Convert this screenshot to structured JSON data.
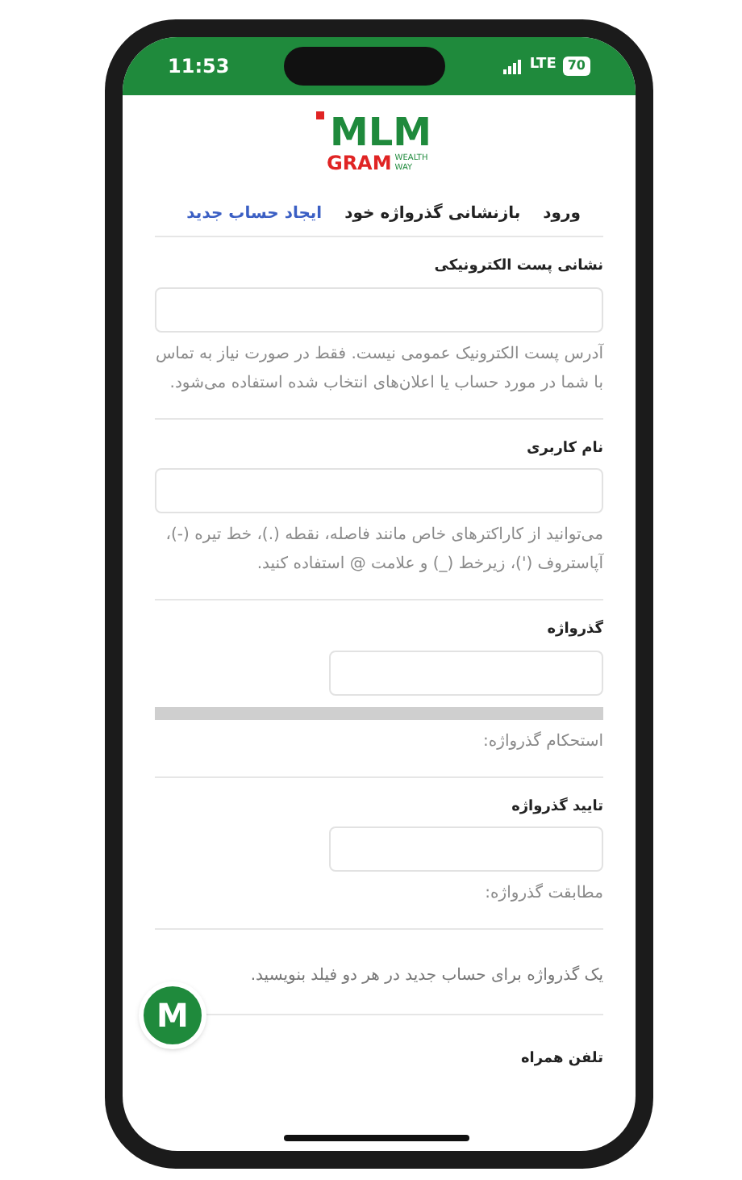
{
  "status_bar": {
    "time": "11:53",
    "network": "LTE",
    "battery": "70"
  },
  "logo": {
    "mark": "MLM",
    "word": "GRAM",
    "tagline": "WEALTH WAY"
  },
  "tabs": [
    {
      "label": "ورود",
      "selected": false
    },
    {
      "label": "بازنشانی گذرواژه خود",
      "selected": false
    },
    {
      "label": "ایجاد حساب جدید",
      "selected": true
    }
  ],
  "sections": [
    {
      "kind": "field",
      "label": "نشانی پست الکترونیکی",
      "hint": "آدرس پست الکترونیک عمومی نیست. فقط در صورت نیاز به تماس با شما در مورد حساب یا اعلان‌های انتخاب شده استفاده می‌شود."
    },
    {
      "kind": "field",
      "label": "نام کاربری",
      "hint": "می‌توانید از کاراکترهای خاص مانند فاصله، نقطه (.)، خط تیره (-)، آپاستروف (')، زیرخط (_) و علامت @ استفاده کنید."
    },
    {
      "kind": "meter",
      "label": "گذرواژه",
      "level": 0,
      "hint": "استحکام گذرواژه:"
    },
    {
      "kind": "short_field",
      "label": "تایید گذرواژه",
      "hint": "مطابقت گذرواژه:"
    },
    {
      "kind": "note",
      "hint": "یک گذرواژه برای حساب جدید در هر دو فیلد بنویسید."
    },
    {
      "kind": "heading",
      "label": "تلفن همراه"
    }
  ],
  "chat_badge": {
    "letter": "M"
  }
}
